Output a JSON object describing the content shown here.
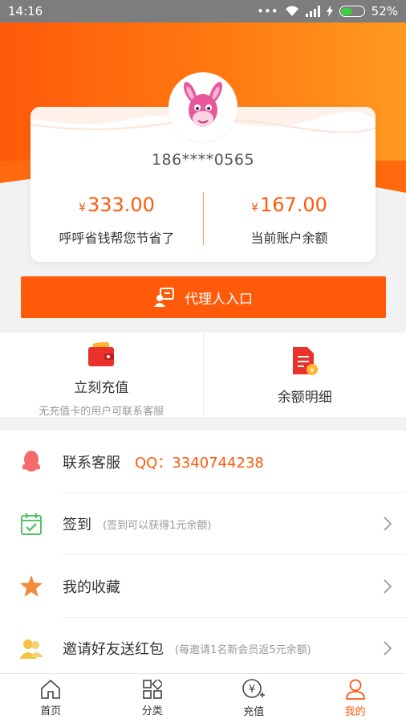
{
  "status_bar": {
    "time": "14:16",
    "battery": "52%",
    "battery_level": 0.52
  },
  "profile": {
    "phone": "186****0565",
    "saved_currency": "¥",
    "saved_amount": "333.00",
    "saved_label": "呼呼省钱帮您节省了",
    "balance_currency": "¥",
    "balance_amount": "167.00",
    "balance_label": "当前账户余额"
  },
  "agent_button": {
    "label": "代理人入口"
  },
  "tiles": [
    {
      "title": "立刻充值",
      "subtitle": "无充值卡的用户可联系客服"
    },
    {
      "title": "余额明细"
    }
  ],
  "list": {
    "service": {
      "title": "联系客服",
      "qq": "QQ：3340744238"
    },
    "checkin": {
      "title": "签到",
      "note": "(签到可以获得1元余额)"
    },
    "favorites": {
      "title": "我的收藏"
    },
    "invite": {
      "title": "邀请好友送红包",
      "note": "(每邀请1名新会员返5元余额)"
    }
  },
  "bottom_nav": [
    {
      "label": "首页"
    },
    {
      "label": "分类"
    },
    {
      "label": "充值"
    },
    {
      "label": "我的",
      "active": true
    }
  ],
  "colors": {
    "accent": "#ff5a0a"
  }
}
